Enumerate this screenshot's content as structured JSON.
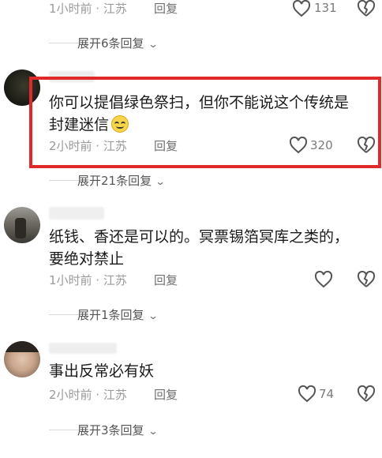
{
  "top_row": {
    "meta": "1小时前 · 江苏",
    "reply": "回复",
    "likes": "131"
  },
  "expand_1": {
    "label": "展开6条回复"
  },
  "comment_1": {
    "text_line1": "你可以提倡绿色祭扫，但你不能说这个传统是",
    "text_line2": "封建迷信",
    "meta": "2小时前 · 江苏",
    "reply": "回复",
    "likes": "320"
  },
  "expand_2": {
    "label": "展开21条回复"
  },
  "comment_2": {
    "text_line1": "纸钱、香还是可以的。冥票锡箔冥库之类的，",
    "text_line2": "要绝对禁止",
    "meta": "1小时前 · 江苏",
    "reply": "回复"
  },
  "expand_3": {
    "label": "展开1条回复"
  },
  "comment_3": {
    "text_line1": "事出反常必有妖",
    "meta": "2小时前 · 江苏",
    "reply": "回复",
    "likes": "74"
  },
  "expand_4": {
    "label": "展开3条回复"
  },
  "colors": {
    "highlight": "#e02a2a",
    "meta": "#9a9a9a"
  },
  "icons": [
    "heart-icon",
    "broken-heart-icon",
    "chevron-down-icon",
    "emoji-icon"
  ]
}
